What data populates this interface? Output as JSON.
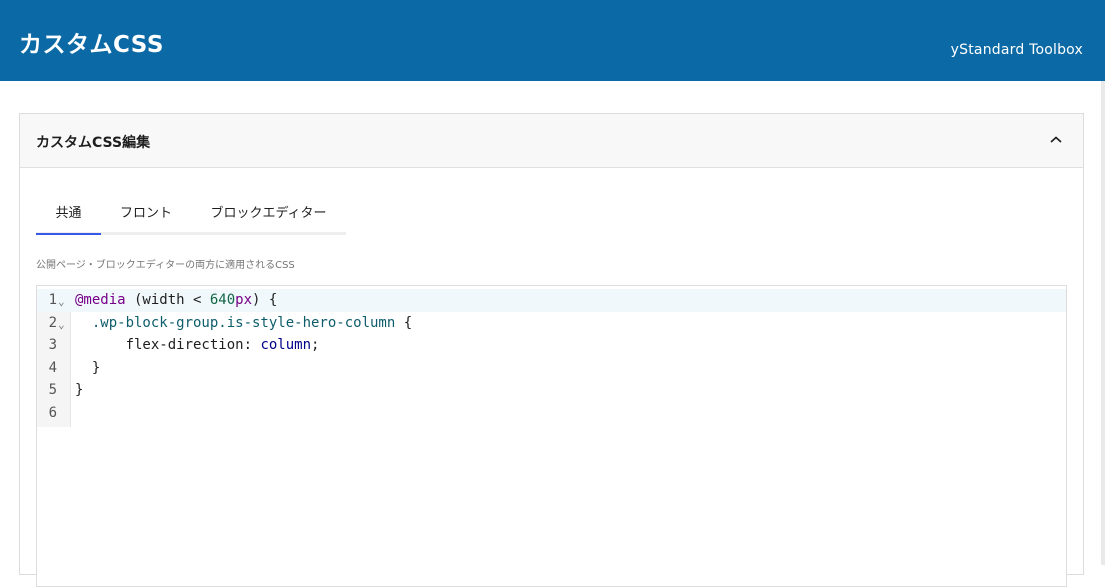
{
  "header": {
    "title": "カスタムCSS",
    "brand": "yStandard Toolbox"
  },
  "panel": {
    "title": "カスタムCSS編集",
    "collapse_icon": "chevron-up-icon"
  },
  "tabs": [
    {
      "label": "共通",
      "active": true
    },
    {
      "label": "フロント",
      "active": false
    },
    {
      "label": "ブロックエディター",
      "active": false
    }
  ],
  "hint": "公開ページ・ブロックエディターの両方に適用されるCSS",
  "editor": {
    "line_numbers": [
      "1",
      "2",
      "3",
      "4",
      "5",
      "6"
    ],
    "lines": [
      {
        "indent": "",
        "at": "@media",
        "pre": " (width < ",
        "num": "640",
        "unit": "px",
        "post": ") {"
      },
      {
        "indent": "  ",
        "selector": ".wp-block-group.is-style-hero-column",
        "post": " {"
      },
      {
        "indent": "      ",
        "prop": "flex-direction",
        "colon": ": ",
        "val": "column",
        "post": ";"
      },
      {
        "text": "  }"
      },
      {
        "text": "}"
      },
      {
        "text": ""
      }
    ],
    "accent_color": "#3858e9",
    "header_color": "#0b6aa6"
  }
}
